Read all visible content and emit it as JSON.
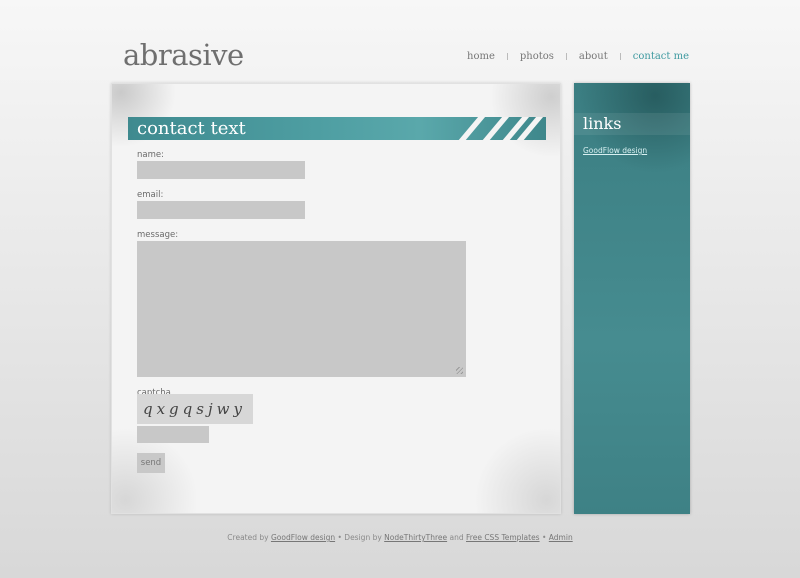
{
  "site": {
    "logo": "abrasive"
  },
  "nav": {
    "items": [
      {
        "label": "home"
      },
      {
        "label": "photos"
      },
      {
        "label": "about"
      },
      {
        "label": "contact me",
        "active": true
      }
    ]
  },
  "content": {
    "title": "contact text",
    "form": {
      "name_label": "name:",
      "email_label": "email:",
      "message_label": "message:",
      "captcha_label": "captcha",
      "captcha_text": "qxgqsjwy",
      "send_label": "send"
    }
  },
  "sidebar": {
    "title": "links",
    "link": "GoodFlow design"
  },
  "footer": {
    "created_by": "Created by",
    "goodflow": "GoodFlow design",
    "design_by": "Design by",
    "nodethirtythree": "NodeThirtyThree",
    "and": "and",
    "free_css": "Free CSS Templates",
    "admin": "Admin"
  },
  "colors": {
    "accent": "#3f9aa0",
    "sidebar": "#43878b",
    "field": "#c8c8c8"
  }
}
